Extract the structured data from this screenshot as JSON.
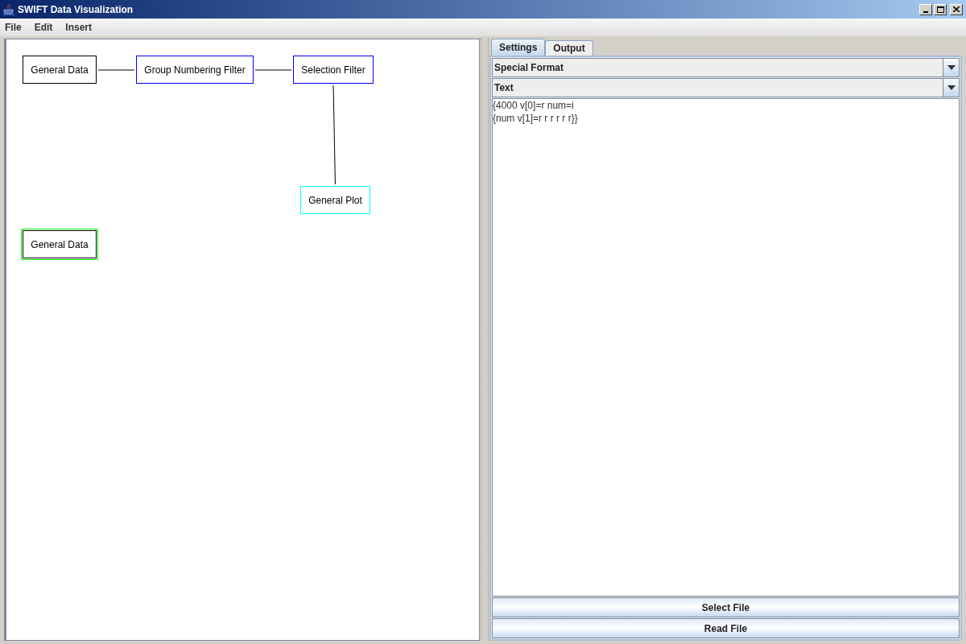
{
  "window": {
    "title": "SWIFT Data Visualization"
  },
  "menu": [
    {
      "label": "File"
    },
    {
      "label": "Edit"
    },
    {
      "label": "Insert"
    }
  ],
  "canvas": {
    "nodes": [
      {
        "label": "General Data",
        "color": "#000000",
        "selected": false
      },
      {
        "label": "Group Numbering Filter",
        "color": "#0000ff",
        "selected": false
      },
      {
        "label": "Selection Filter",
        "color": "#0000ff",
        "selected": false
      },
      {
        "label": "General Plot",
        "color": "#00ffff",
        "selected": false
      },
      {
        "label": "General Data",
        "color": "#000000",
        "selected": true
      }
    ]
  },
  "tabs": [
    {
      "label": "Settings",
      "selected": true
    },
    {
      "label": "Output",
      "selected": false
    }
  ],
  "dropdowns": [
    {
      "value": "Special Format"
    },
    {
      "value": "Text"
    }
  ],
  "format_text": "{4000 v[0]=r num=i\n{num v[1]=r r r r r r}}",
  "buttons": [
    "Select File",
    "Read File"
  ]
}
